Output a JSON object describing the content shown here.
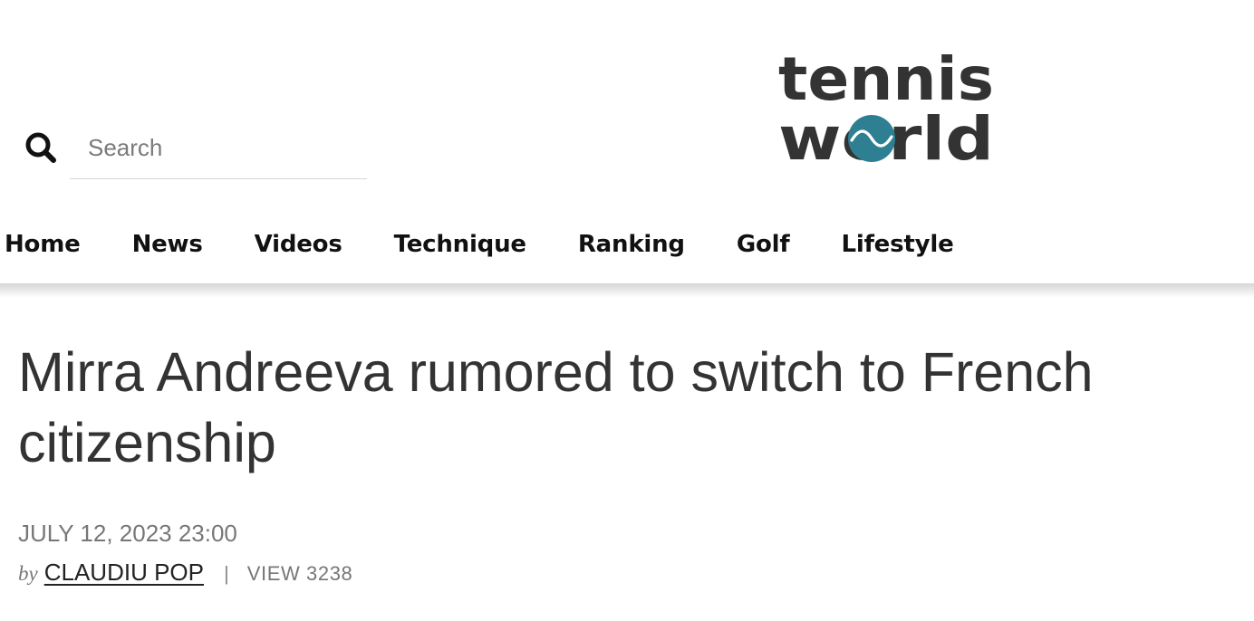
{
  "search": {
    "placeholder": "Search"
  },
  "logo": {
    "line1": "tennis",
    "line2": "world"
  },
  "nav": {
    "items": [
      {
        "label": "Home"
      },
      {
        "label": "News"
      },
      {
        "label": "Videos"
      },
      {
        "label": "Technique"
      },
      {
        "label": "Ranking"
      },
      {
        "label": "Golf"
      },
      {
        "label": "Lifestyle"
      }
    ]
  },
  "article": {
    "title": "Mirra Andreeva rumored to switch to French citizenship",
    "date": "JULY 12, 2023 23:00",
    "by_label": "by",
    "author": "CLAUDIU POP",
    "separator": "|",
    "views": "VIEW 3238"
  },
  "colors": {
    "logo_text": "#333333",
    "logo_ball": "#2e7f92",
    "nav_text": "#111111",
    "headline": "#333333",
    "meta": "#777777"
  }
}
